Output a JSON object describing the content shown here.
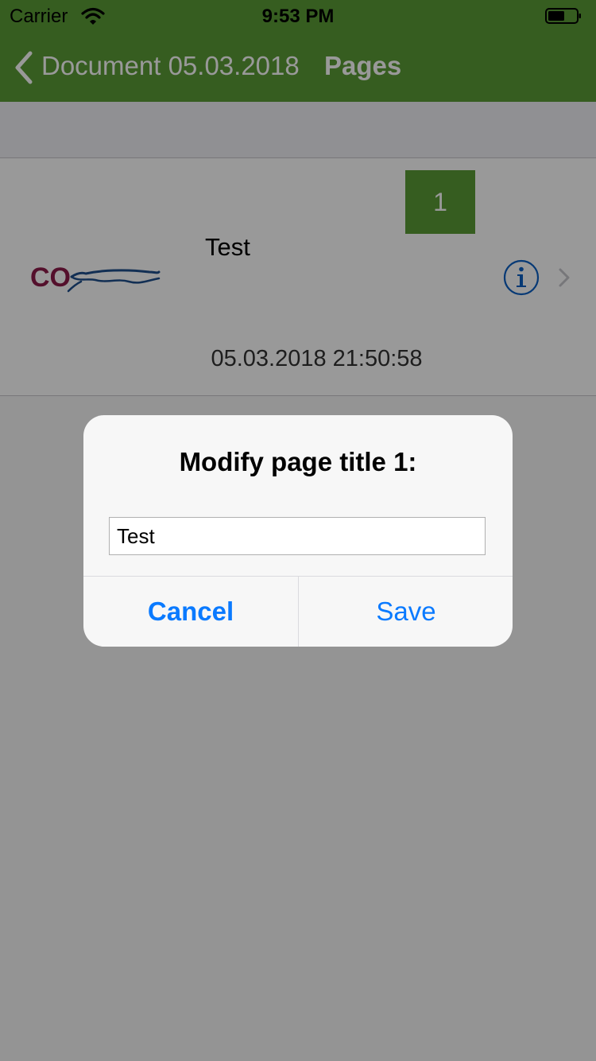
{
  "status_bar": {
    "carrier": "Carrier",
    "time": "9:53 PM",
    "icons": [
      "wifi-icon",
      "battery-icon"
    ]
  },
  "nav": {
    "back_label": "Document 05.03.2018",
    "title": "Pages",
    "bar_color": "#5a9c36",
    "icons": [
      "chevron-left-icon"
    ]
  },
  "page_cell": {
    "logo_text": "COweave",
    "title": "Test",
    "page_number": "1",
    "date": "05.03.2018 21:50:58",
    "icons": [
      "info-icon",
      "chevron-right-icon"
    ]
  },
  "alert": {
    "title": "Modify page title 1:",
    "input_value": "Test",
    "cancel_label": "Cancel",
    "save_label": "Save",
    "accent_color": "#0a7aff"
  }
}
